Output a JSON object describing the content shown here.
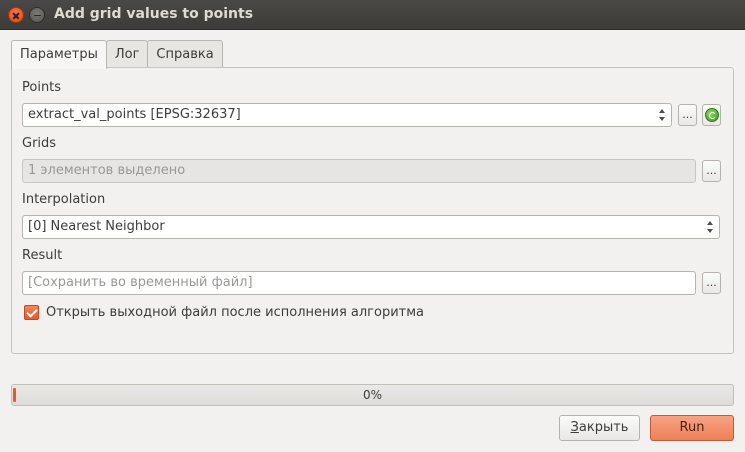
{
  "window": {
    "title": "Add grid values to points"
  },
  "tabs": [
    {
      "label": "Параметры",
      "active": true
    },
    {
      "label": "Лог",
      "active": false
    },
    {
      "label": "Справка",
      "active": false
    }
  ],
  "params": {
    "points": {
      "label": "Points",
      "value": "extract_val_points [EPSG:32637]",
      "browse": "...",
      "iterate_icon": "iterate-icon"
    },
    "grids": {
      "label": "Grids",
      "value": "1 элементов выделено",
      "browse": "..."
    },
    "interpolation": {
      "label": "Interpolation",
      "value": "[0] Nearest Neighbor"
    },
    "result": {
      "label": "Result",
      "placeholder": "[Сохранить во временный файл]",
      "browse": "..."
    },
    "open_output": {
      "label": "Открыть выходной файл после исполнения алгоритма",
      "checked": true
    }
  },
  "progress": {
    "value": 0,
    "text": "0%"
  },
  "buttons": {
    "close": "Закрыть",
    "run": "Run"
  },
  "colors": {
    "accent": "#e45a2c",
    "run_button": "#ee8058"
  }
}
